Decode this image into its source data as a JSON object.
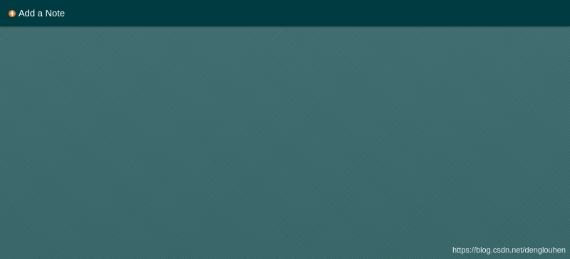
{
  "topbar": {
    "add_note_label": "Add a Note",
    "add_icon": "plus-circle-icon",
    "background_color": "#003b41",
    "icon_color": "#e07a2e"
  },
  "canvas": {
    "background_color": "#3a6b6d",
    "watermark": "https://blog.csdn.net/denglouhen"
  }
}
